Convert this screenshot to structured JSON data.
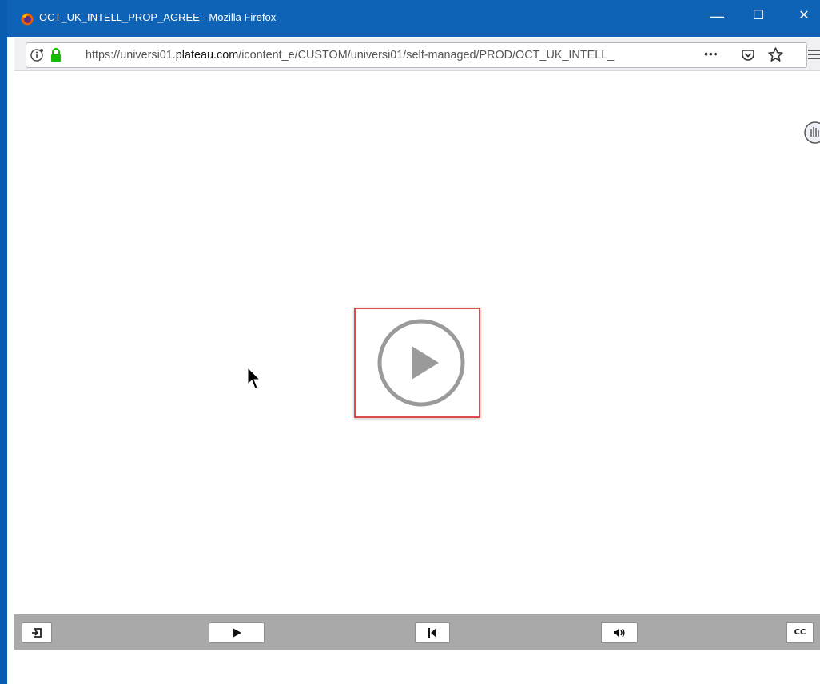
{
  "window": {
    "title": "OCT_UK_INTELL_PROP_AGREE - Mozilla Firefox",
    "minimize_glyph": "—",
    "maximize_glyph": "☐",
    "close_glyph": "✕"
  },
  "urlbar": {
    "url_prefix": "https://universi01.",
    "url_domain": "plateau.com",
    "url_suffix": "/icontent_e/CUSTOM/universi01/self-managed/PROD/OCT_UK_INTELL_",
    "page_actions_glyph": "•••",
    "icons": [
      "info-icon",
      "lock-icon",
      "pocket-icon",
      "bookmark-star-icon",
      "menu-icon"
    ]
  },
  "player": {
    "big_play_icon": "play-circle-icon",
    "controls": [
      {
        "name": "exit-button",
        "icon": "exit-icon"
      },
      {
        "name": "play-button",
        "icon": "play-icon"
      },
      {
        "name": "rewind-button",
        "icon": "skip-back-icon"
      },
      {
        "name": "volume-button",
        "icon": "speaker-icon"
      },
      {
        "name": "cc-button",
        "label": "CC"
      }
    ]
  },
  "colors": {
    "titlebar": "#0f63b6",
    "highlight_border": "#e24a4a",
    "control_bar": "#a9a9a9",
    "play_circle": "#9a9a9a"
  }
}
